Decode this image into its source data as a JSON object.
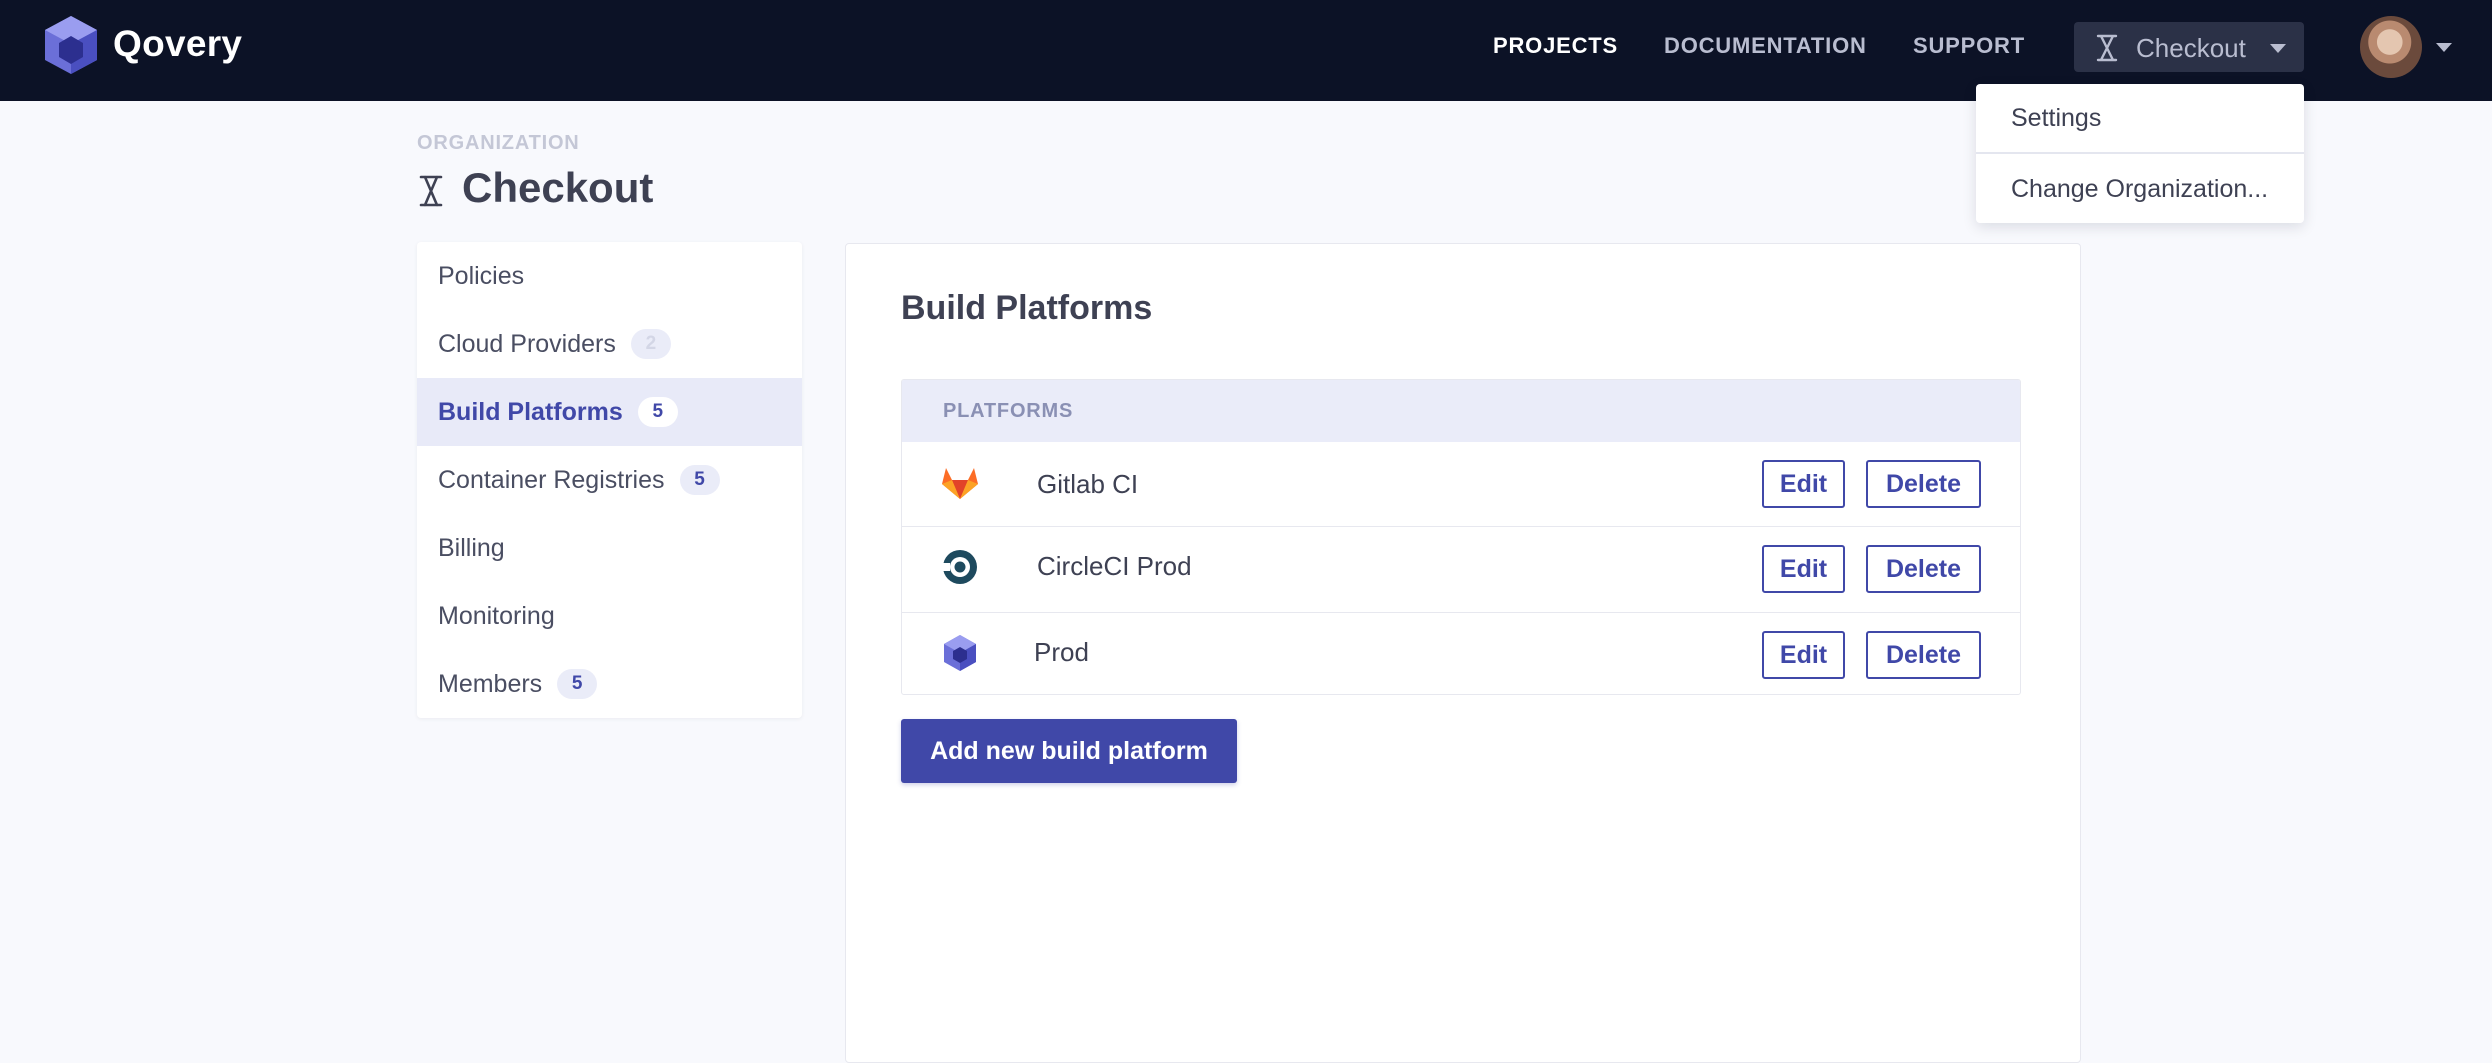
{
  "app": {
    "brand": "Qovery"
  },
  "topnav": {
    "items": [
      {
        "label": "PROJECTS",
        "active": true
      },
      {
        "label": "DOCUMENTATION",
        "active": false
      },
      {
        "label": "SUPPORT",
        "active": false
      }
    ],
    "org_selector": {
      "label": "Checkout",
      "icon": "hourglass-icon"
    }
  },
  "dropdown": {
    "items": [
      "Settings",
      "Change Organization..."
    ]
  },
  "header": {
    "section_label": "ORGANIZATION",
    "title": "Checkout"
  },
  "sidebar": {
    "items": [
      {
        "label": "Policies",
        "badge": null,
        "active": false
      },
      {
        "label": "Cloud Providers",
        "badge": "2",
        "active": false
      },
      {
        "label": "Build Platforms",
        "badge": "5",
        "active": true
      },
      {
        "label": "Container Registries",
        "badge": "5",
        "active": false
      },
      {
        "label": "Billing",
        "badge": null,
        "active": false
      },
      {
        "label": "Monitoring",
        "badge": null,
        "active": false
      },
      {
        "label": "Members",
        "badge": "5",
        "active": false
      }
    ]
  },
  "main": {
    "title": "Build Platforms",
    "table": {
      "header": "PLATFORMS",
      "rows": [
        {
          "name": "Gitlab CI",
          "icon": "gitlab-icon",
          "edit_label": "Edit",
          "delete_label": "Delete"
        },
        {
          "name": "CircleCI Prod",
          "icon": "circleci-icon",
          "edit_label": "Edit",
          "delete_label": "Delete"
        },
        {
          "name": "Prod",
          "icon": "qovery-icon",
          "edit_label": "Edit",
          "delete_label": "Delete"
        }
      ]
    },
    "add_button_label": "Add new build platform"
  },
  "colors": {
    "topbar": "#0c1226",
    "accent": "#4048a8",
    "active_bg": "#e8eaf8",
    "page_bg": "#f8f9fd"
  }
}
